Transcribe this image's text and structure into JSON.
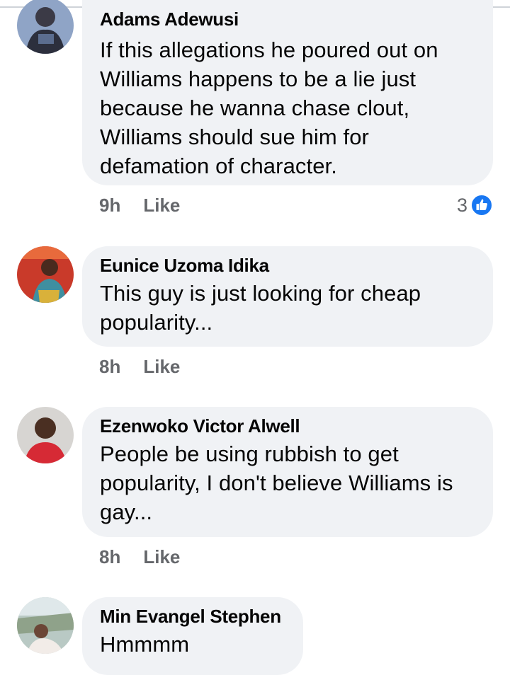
{
  "comments": [
    {
      "author": "Adams Adewusi",
      "text": "If this allegations he poured out on Williams happens to be a lie just because he wanna chase clout, Williams should sue him for defamation of character.",
      "time": "9h",
      "like_label": "Like",
      "reaction_count": "3",
      "reaction_icon": "thumbs-up-icon"
    },
    {
      "author": "Eunice Uzoma Idika",
      "text": "This guy is just looking for cheap popularity...",
      "time": "8h",
      "like_label": "Like"
    },
    {
      "author": "Ezenwoko Victor Alwell",
      "text": "People be using rubbish to get popularity, I don't believe Williams is gay...",
      "time": "8h",
      "like_label": "Like"
    },
    {
      "author": "Min Evangel Stephen",
      "text": "Hmmmm"
    }
  ],
  "colors": {
    "bubble_bg": "#f0f2f5",
    "author_text": "#050505",
    "meta_text": "#65676b",
    "like_blue": "#1877f2"
  }
}
